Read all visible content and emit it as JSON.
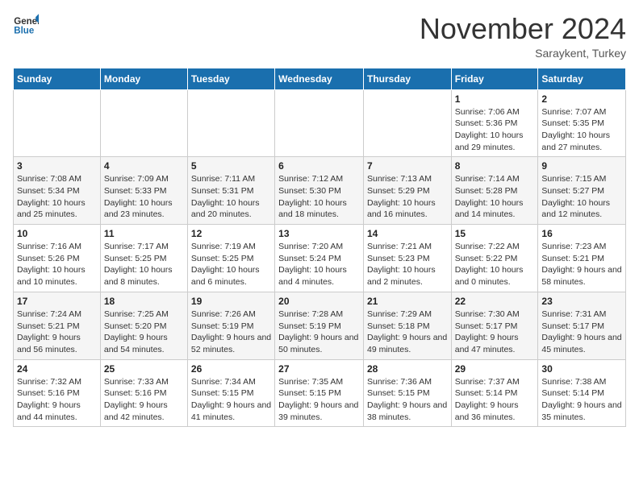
{
  "header": {
    "logo_line1": "General",
    "logo_line2": "Blue",
    "month": "November 2024",
    "location": "Saraykent, Turkey"
  },
  "weekdays": [
    "Sunday",
    "Monday",
    "Tuesday",
    "Wednesday",
    "Thursday",
    "Friday",
    "Saturday"
  ],
  "weeks": [
    [
      {
        "day": "",
        "info": ""
      },
      {
        "day": "",
        "info": ""
      },
      {
        "day": "",
        "info": ""
      },
      {
        "day": "",
        "info": ""
      },
      {
        "day": "",
        "info": ""
      },
      {
        "day": "1",
        "info": "Sunrise: 7:06 AM\nSunset: 5:36 PM\nDaylight: 10 hours and 29 minutes."
      },
      {
        "day": "2",
        "info": "Sunrise: 7:07 AM\nSunset: 5:35 PM\nDaylight: 10 hours and 27 minutes."
      }
    ],
    [
      {
        "day": "3",
        "info": "Sunrise: 7:08 AM\nSunset: 5:34 PM\nDaylight: 10 hours and 25 minutes."
      },
      {
        "day": "4",
        "info": "Sunrise: 7:09 AM\nSunset: 5:33 PM\nDaylight: 10 hours and 23 minutes."
      },
      {
        "day": "5",
        "info": "Sunrise: 7:11 AM\nSunset: 5:31 PM\nDaylight: 10 hours and 20 minutes."
      },
      {
        "day": "6",
        "info": "Sunrise: 7:12 AM\nSunset: 5:30 PM\nDaylight: 10 hours and 18 minutes."
      },
      {
        "day": "7",
        "info": "Sunrise: 7:13 AM\nSunset: 5:29 PM\nDaylight: 10 hours and 16 minutes."
      },
      {
        "day": "8",
        "info": "Sunrise: 7:14 AM\nSunset: 5:28 PM\nDaylight: 10 hours and 14 minutes."
      },
      {
        "day": "9",
        "info": "Sunrise: 7:15 AM\nSunset: 5:27 PM\nDaylight: 10 hours and 12 minutes."
      }
    ],
    [
      {
        "day": "10",
        "info": "Sunrise: 7:16 AM\nSunset: 5:26 PM\nDaylight: 10 hours and 10 minutes."
      },
      {
        "day": "11",
        "info": "Sunrise: 7:17 AM\nSunset: 5:25 PM\nDaylight: 10 hours and 8 minutes."
      },
      {
        "day": "12",
        "info": "Sunrise: 7:19 AM\nSunset: 5:25 PM\nDaylight: 10 hours and 6 minutes."
      },
      {
        "day": "13",
        "info": "Sunrise: 7:20 AM\nSunset: 5:24 PM\nDaylight: 10 hours and 4 minutes."
      },
      {
        "day": "14",
        "info": "Sunrise: 7:21 AM\nSunset: 5:23 PM\nDaylight: 10 hours and 2 minutes."
      },
      {
        "day": "15",
        "info": "Sunrise: 7:22 AM\nSunset: 5:22 PM\nDaylight: 10 hours and 0 minutes."
      },
      {
        "day": "16",
        "info": "Sunrise: 7:23 AM\nSunset: 5:21 PM\nDaylight: 9 hours and 58 minutes."
      }
    ],
    [
      {
        "day": "17",
        "info": "Sunrise: 7:24 AM\nSunset: 5:21 PM\nDaylight: 9 hours and 56 minutes."
      },
      {
        "day": "18",
        "info": "Sunrise: 7:25 AM\nSunset: 5:20 PM\nDaylight: 9 hours and 54 minutes."
      },
      {
        "day": "19",
        "info": "Sunrise: 7:26 AM\nSunset: 5:19 PM\nDaylight: 9 hours and 52 minutes."
      },
      {
        "day": "20",
        "info": "Sunrise: 7:28 AM\nSunset: 5:19 PM\nDaylight: 9 hours and 50 minutes."
      },
      {
        "day": "21",
        "info": "Sunrise: 7:29 AM\nSunset: 5:18 PM\nDaylight: 9 hours and 49 minutes."
      },
      {
        "day": "22",
        "info": "Sunrise: 7:30 AM\nSunset: 5:17 PM\nDaylight: 9 hours and 47 minutes."
      },
      {
        "day": "23",
        "info": "Sunrise: 7:31 AM\nSunset: 5:17 PM\nDaylight: 9 hours and 45 minutes."
      }
    ],
    [
      {
        "day": "24",
        "info": "Sunrise: 7:32 AM\nSunset: 5:16 PM\nDaylight: 9 hours and 44 minutes."
      },
      {
        "day": "25",
        "info": "Sunrise: 7:33 AM\nSunset: 5:16 PM\nDaylight: 9 hours and 42 minutes."
      },
      {
        "day": "26",
        "info": "Sunrise: 7:34 AM\nSunset: 5:15 PM\nDaylight: 9 hours and 41 minutes."
      },
      {
        "day": "27",
        "info": "Sunrise: 7:35 AM\nSunset: 5:15 PM\nDaylight: 9 hours and 39 minutes."
      },
      {
        "day": "28",
        "info": "Sunrise: 7:36 AM\nSunset: 5:15 PM\nDaylight: 9 hours and 38 minutes."
      },
      {
        "day": "29",
        "info": "Sunrise: 7:37 AM\nSunset: 5:14 PM\nDaylight: 9 hours and 36 minutes."
      },
      {
        "day": "30",
        "info": "Sunrise: 7:38 AM\nSunset: 5:14 PM\nDaylight: 9 hours and 35 minutes."
      }
    ]
  ]
}
